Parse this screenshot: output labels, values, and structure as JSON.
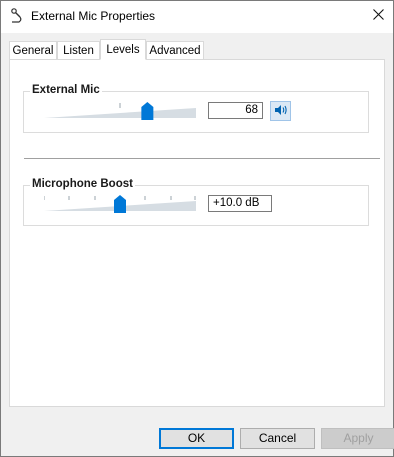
{
  "window": {
    "title": "External Mic Properties",
    "icon": "microphone-icon",
    "close_icon": "close-icon"
  },
  "tabs": [
    {
      "label": "General",
      "active": false
    },
    {
      "label": "Listen",
      "active": false
    },
    {
      "label": "Levels",
      "active": true
    },
    {
      "label": "Advanced",
      "active": false
    }
  ],
  "levels": {
    "mic": {
      "label": "External Mic",
      "value": "68",
      "level": 0.68,
      "speaker_icon": "speaker-volume-icon"
    },
    "boost": {
      "label": "Microphone Boost",
      "value": "+10.0 dB",
      "level": 0.5
    }
  },
  "buttons": {
    "ok": "OK",
    "cancel": "Cancel",
    "apply": "Apply"
  },
  "colors": {
    "accent": "#0078d7",
    "track": "#d6dde3",
    "tick": "#9aa4ad"
  }
}
